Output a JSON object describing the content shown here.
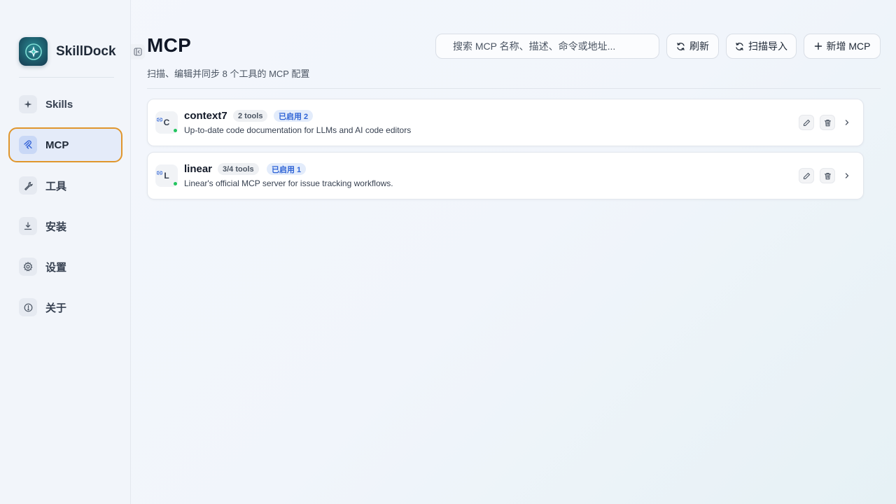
{
  "app": {
    "name": "SkillDock"
  },
  "sidebar": {
    "items": [
      {
        "label": "Skills",
        "icon": "sparkle-icon",
        "active": false
      },
      {
        "label": "MCP",
        "icon": "mcp-icon",
        "active": true
      },
      {
        "label": "工具",
        "icon": "wrench-icon",
        "active": false
      },
      {
        "label": "安装",
        "icon": "download-icon",
        "active": false
      },
      {
        "label": "设置",
        "icon": "gear-icon",
        "active": false
      },
      {
        "label": "关于",
        "icon": "info-icon",
        "active": false
      }
    ]
  },
  "header": {
    "title": "MCP",
    "subtitle": "扫描、编辑并同步 8 个工具的 MCP 配置",
    "search_placeholder": "搜索 MCP 名称、描述、命令或地址...",
    "refresh_label": "刷新",
    "scan_import_label": "扫描导入",
    "add_label": "新增 MCP"
  },
  "servers": [
    {
      "initial": "C",
      "name": "context7",
      "tools_badge": "2 tools",
      "enabled_badge": "已启用 2",
      "description": "Up-to-date code documentation for LLMs and AI code editors",
      "status": "online"
    },
    {
      "initial": "L",
      "name": "linear",
      "tools_badge": "3/4 tools",
      "enabled_badge": "已启用 1",
      "description": "Linear's official MCP server for issue tracking workflows.",
      "status": "online"
    }
  ],
  "colors": {
    "accent": "#2f64d6",
    "active_border": "#e0962c",
    "status_online": "#22c55e"
  }
}
